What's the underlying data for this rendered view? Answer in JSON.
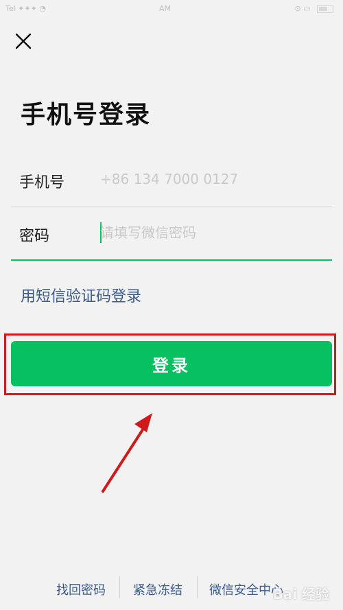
{
  "status_bar": {
    "carrier": "Tel ✦✦✦ ◔",
    "time": "AM",
    "right_icons": "⊙ ▭"
  },
  "header": {
    "close_icon": "close-icon",
    "title": "手机号登录"
  },
  "form": {
    "phone_label": "手机号",
    "phone_value": "+86 134 7000 0127",
    "password_label": "密码",
    "password_placeholder": "请填写微信密码"
  },
  "sms_login_label": "用短信验证码登录",
  "login_button_label": "登录",
  "annotation": {
    "box_color": "#d01a1a",
    "arrow_color": "#d01a1a"
  },
  "footer": {
    "links": [
      "找回密码",
      "紧急冻结",
      "微信安全中心"
    ]
  },
  "watermark": "Bai 经验",
  "colors": {
    "accent": "#07c160",
    "link": "#3a5b8a",
    "background": "#f2f2f2"
  }
}
